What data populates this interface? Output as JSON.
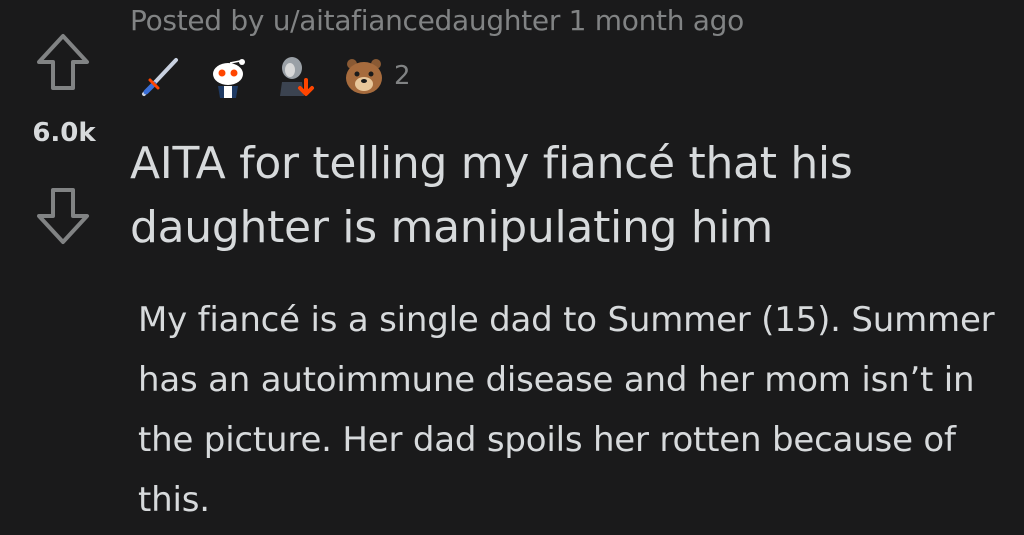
{
  "post": {
    "meta": "Posted by u/aitafiancedaughter 1 month ago",
    "score": "6.0k",
    "award_count": "2",
    "awards": [
      "sword-award-icon",
      "snoo-award-icon",
      "facepalm-award-icon",
      "bear-award-icon"
    ],
    "title": "AITA for telling my fiancé that his daughter is manipulating him",
    "body": "My fiancé is a single dad to Summer (15). Summer has an autoimmune disease and her mom isn’t in the picture. Her dad spoils her rotten because of this."
  },
  "colors": {
    "background": "#1a1a1b",
    "text_primary": "#d7dadc",
    "text_meta": "#818384",
    "vote_arrow": "#818384",
    "award_orange": "#ff4500"
  }
}
